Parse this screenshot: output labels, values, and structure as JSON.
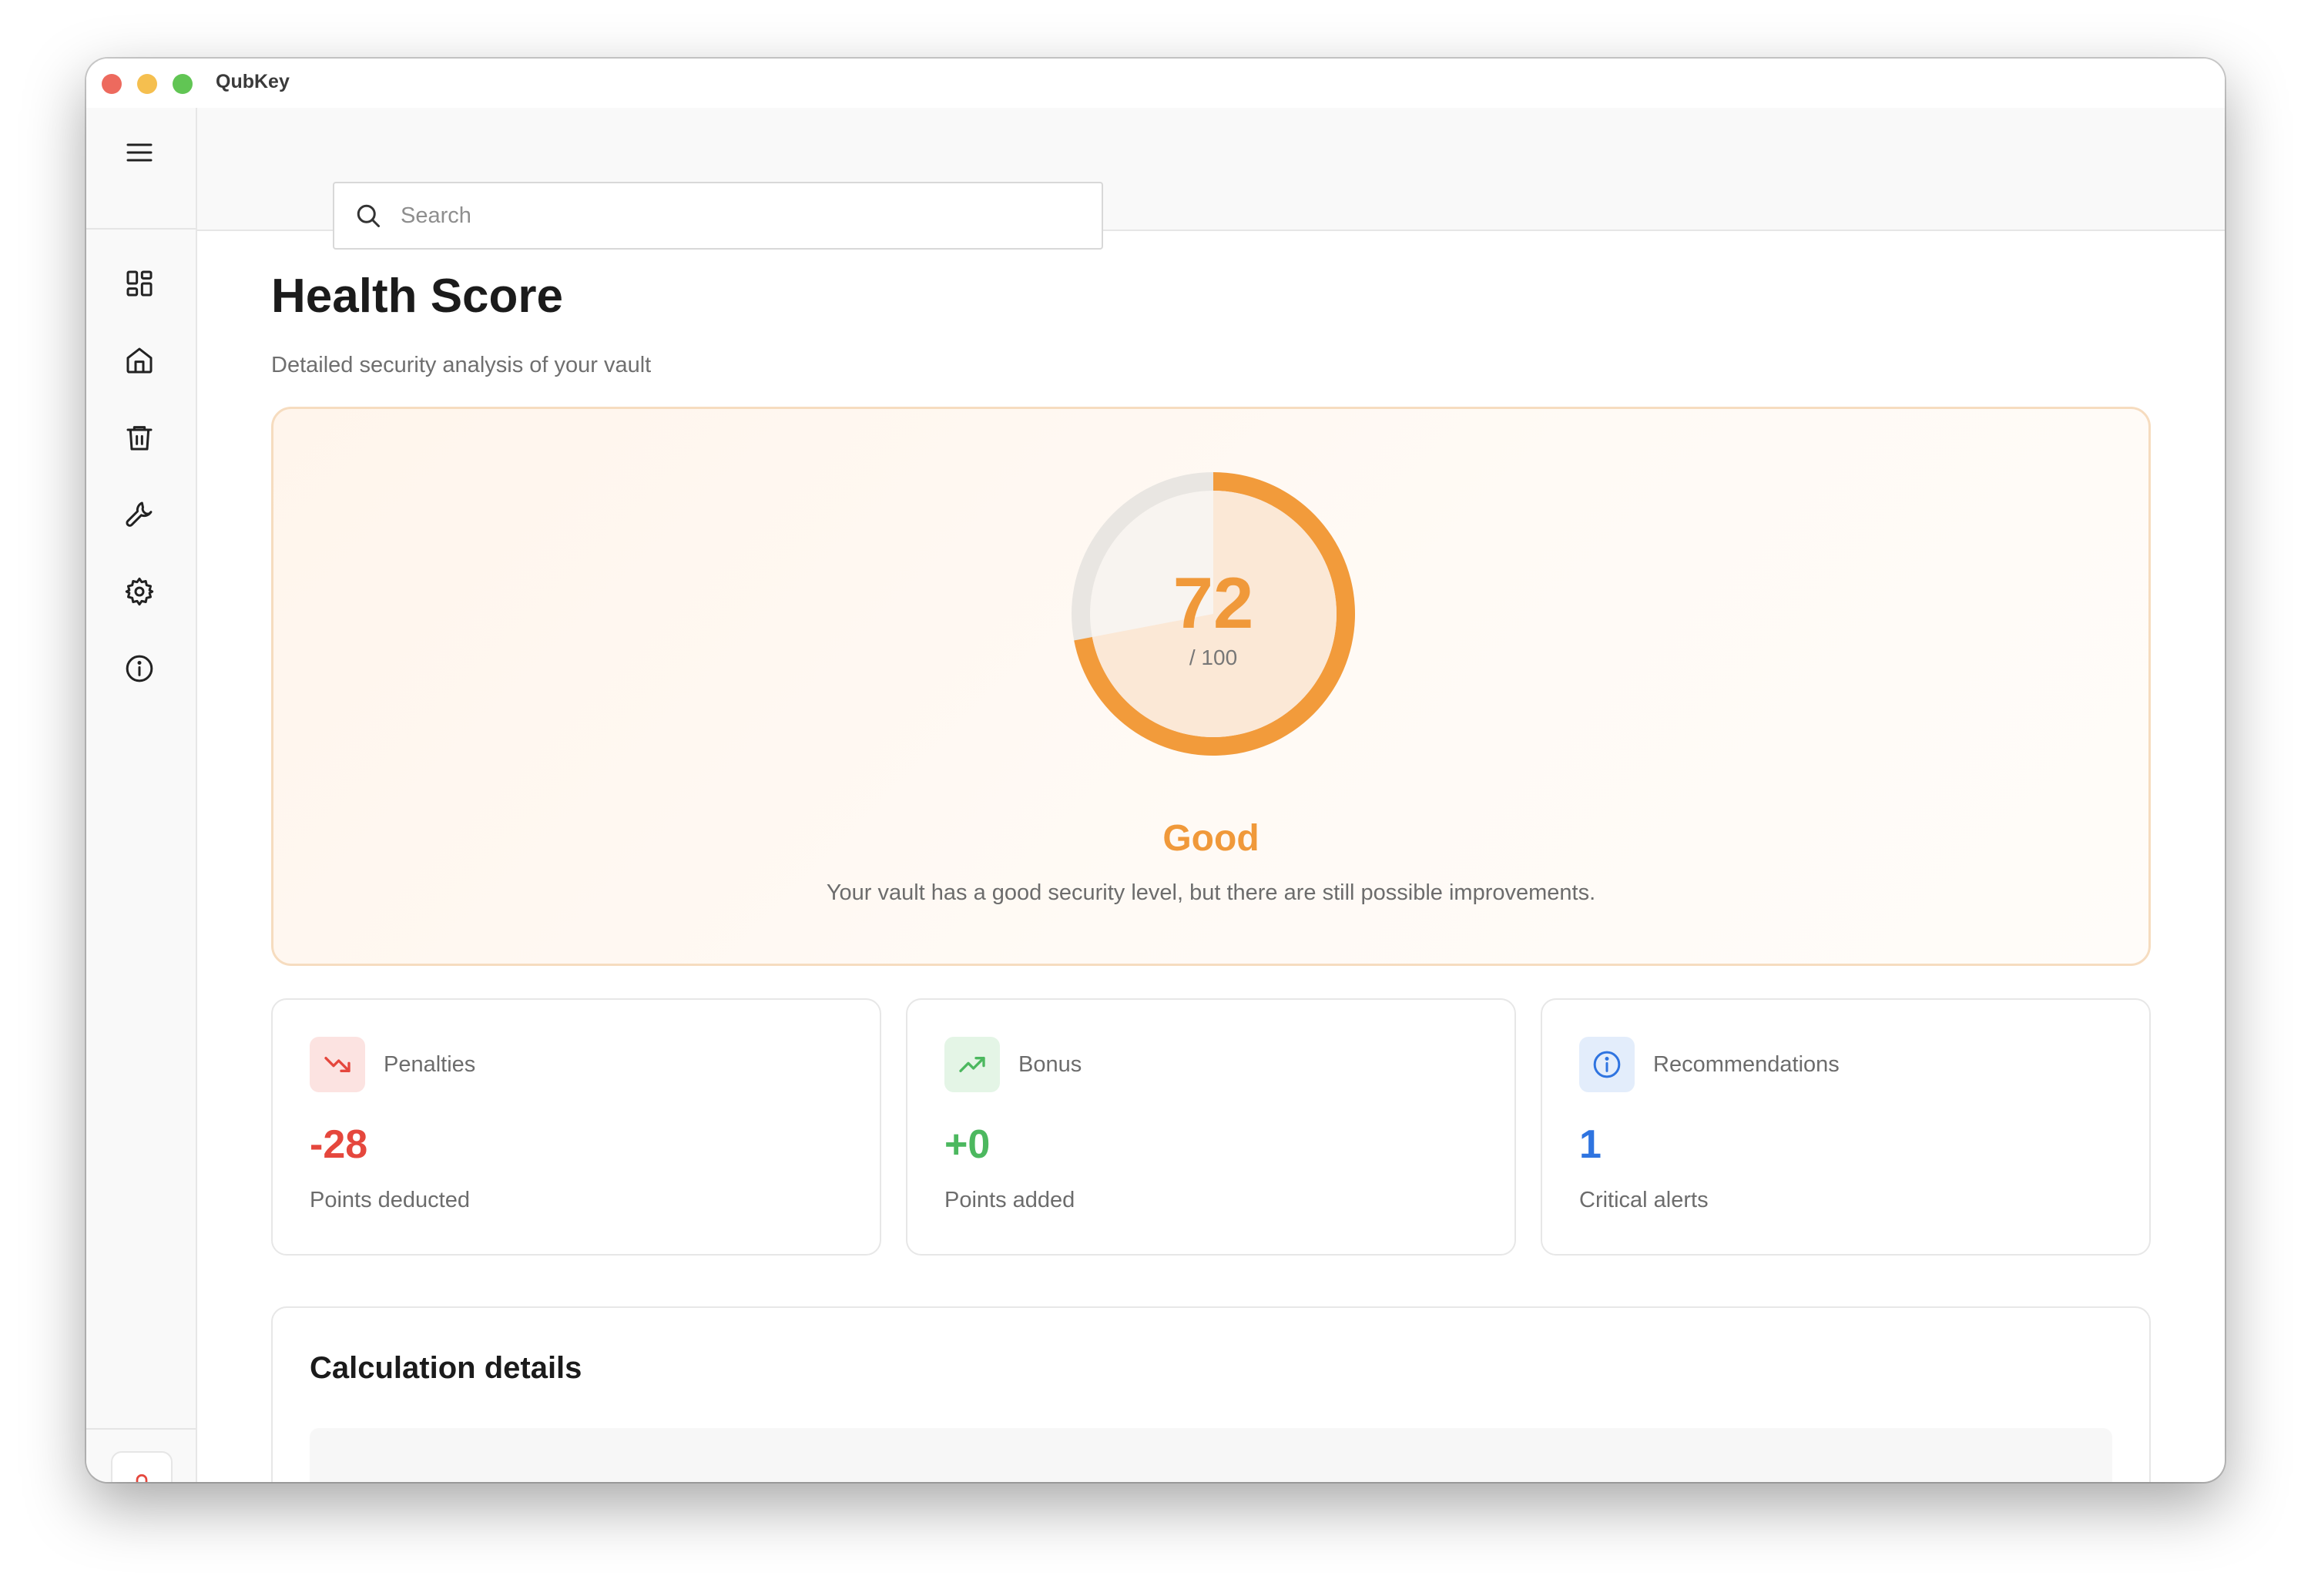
{
  "app": {
    "title": "QubKey"
  },
  "search": {
    "placeholder": "Search"
  },
  "sidebar": {
    "items": [
      {
        "icon": "menu-icon"
      },
      {
        "icon": "dashboard-icon"
      },
      {
        "icon": "home-icon"
      },
      {
        "icon": "trash-icon"
      },
      {
        "icon": "wrench-icon"
      },
      {
        "icon": "gear-icon"
      },
      {
        "icon": "info-icon"
      },
      {
        "icon": "lock-icon"
      }
    ]
  },
  "header": {
    "title": "Health Score",
    "subtitle": "Detailed security analysis of your vault"
  },
  "score": {
    "value": "72",
    "max_label": "/ 100",
    "value_fraction": 0.72,
    "label": "Good",
    "description": "Your vault has a good security level, but there are still possible improvements.",
    "color": "#f0993a"
  },
  "stats": [
    {
      "icon": "trending-down-icon",
      "title": "Penalties",
      "value": "-28",
      "subtitle": "Points deducted",
      "color": "#e5473d"
    },
    {
      "icon": "trending-up-icon",
      "title": "Bonus",
      "value": "+0",
      "subtitle": "Points added",
      "color": "#4cb85f"
    },
    {
      "icon": "info-icon",
      "title": "Recommendations",
      "value": "1",
      "subtitle": "Critical alerts",
      "color": "#2f74e0"
    }
  ],
  "details": {
    "title": "Calculation details"
  }
}
